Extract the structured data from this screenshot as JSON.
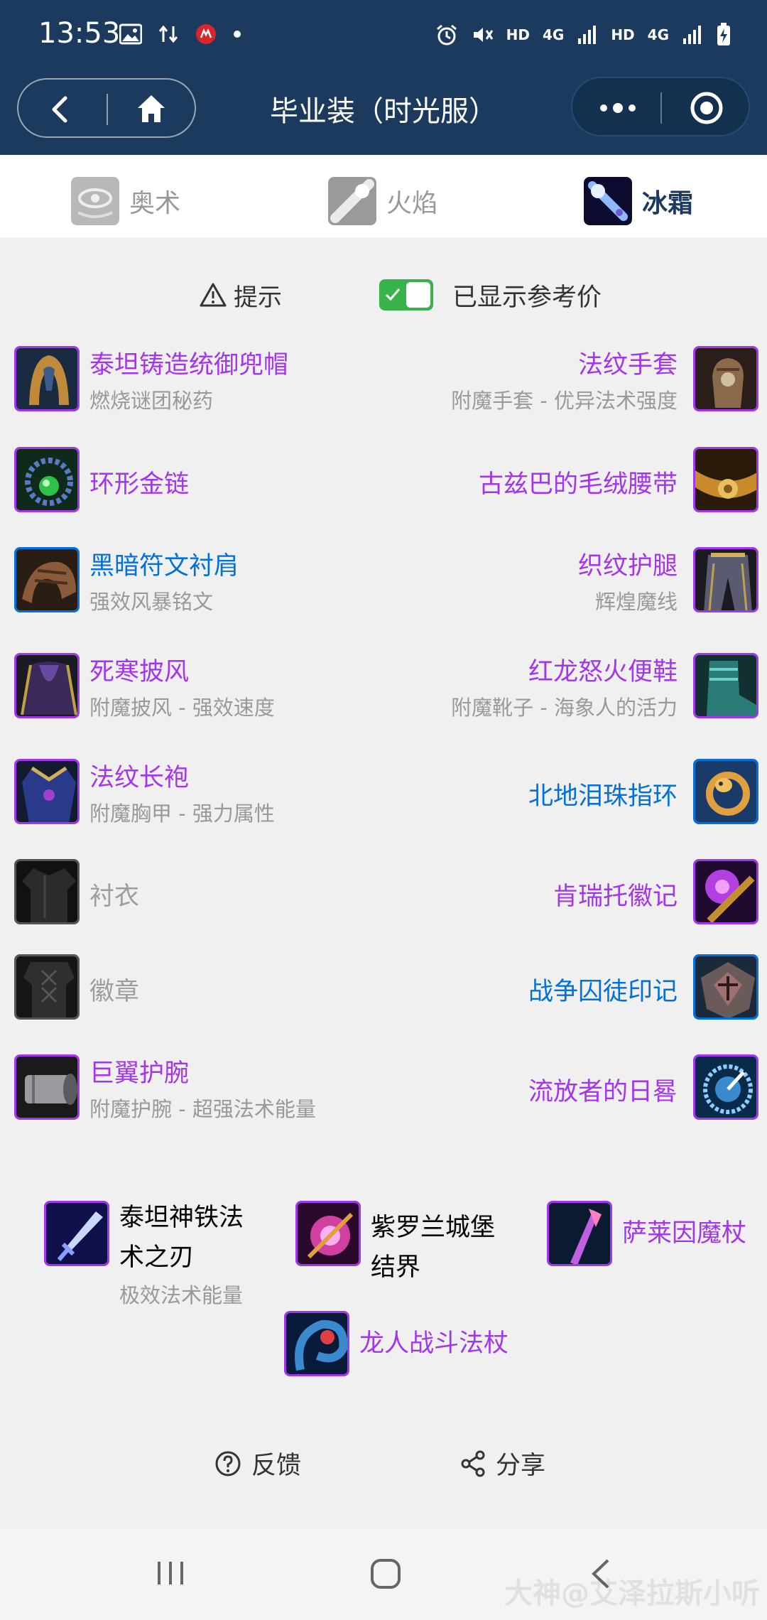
{
  "status": {
    "time": "13:53",
    "network1": "HD",
    "network2": "4G",
    "network3": "HD",
    "network4": "4G"
  },
  "nav": {
    "title": "毕业装（时光服）"
  },
  "tabs": [
    {
      "label": "奥术",
      "active": false
    },
    {
      "label": "火焰",
      "active": false
    },
    {
      "label": "冰霜",
      "active": true
    }
  ],
  "hint": {
    "label": "提示",
    "toggle_label": "已显示参考价",
    "toggle_on": true
  },
  "left_items": [
    {
      "name": "泰坦铸造统御兜帽",
      "sub": "燃烧谜团秘药",
      "quality": "purple",
      "icon": "helmet-icon"
    },
    {
      "name": "环形金链",
      "sub": "",
      "quality": "purple",
      "icon": "necklace-icon"
    },
    {
      "name": "黑暗符文衬肩",
      "sub": "强效风暴铭文",
      "quality": "blue",
      "icon": "shoulder-icon"
    },
    {
      "name": "死寒披风",
      "sub": "附魔披风 - 强效速度",
      "quality": "purple",
      "icon": "cloak-icon"
    },
    {
      "name": "法纹长袍",
      "sub": "附魔胸甲 - 强力属性",
      "quality": "purple",
      "icon": "robe-icon"
    },
    {
      "name": "衬衣",
      "sub": "",
      "quality": "grey",
      "icon": "shirt-icon"
    },
    {
      "name": "徽章",
      "sub": "",
      "quality": "grey",
      "icon": "tabard-icon"
    },
    {
      "name": "巨翼护腕",
      "sub": "附魔护腕 - 超强法术能量",
      "quality": "purple",
      "icon": "bracer-icon"
    }
  ],
  "right_items": [
    {
      "name": "法纹手套",
      "sub": "附魔手套 - 优异法术强度",
      "quality": "purple",
      "icon": "gloves-icon"
    },
    {
      "name": "古兹巴的毛绒腰带",
      "sub": "",
      "quality": "purple",
      "icon": "belt-icon"
    },
    {
      "name": "织纹护腿",
      "sub": "辉煌魔线",
      "quality": "purple",
      "icon": "legs-icon"
    },
    {
      "name": "红龙怒火便鞋",
      "sub": "附魔靴子 - 海象人的活力",
      "quality": "purple",
      "icon": "boots-icon"
    },
    {
      "name": "北地泪珠指环",
      "sub": "",
      "quality": "blue",
      "icon": "ring-icon"
    },
    {
      "name": "肯瑞托徽记",
      "sub": "",
      "quality": "purple",
      "icon": "signet-icon"
    },
    {
      "name": "战争囚徒印记",
      "sub": "",
      "quality": "blue",
      "icon": "trinket-icon"
    },
    {
      "name": "流放者的日晷",
      "sub": "",
      "quality": "purple",
      "icon": "sundial-icon"
    }
  ],
  "weapons": [
    {
      "name_line1": "泰坦神铁法",
      "name_line2": "术之刃",
      "sub": "极效法术能量",
      "quality": "purple",
      "icon": "dagger-icon"
    },
    {
      "name_line1": "紫罗兰城堡",
      "name_line2": "结界",
      "sub": "",
      "quality": "purple",
      "icon": "offhand-icon"
    },
    {
      "name_line1": "萨莱因魔杖",
      "name_line2": "",
      "sub": "",
      "quality": "purple",
      "icon": "wand-icon"
    },
    {
      "name_line1": "龙人战斗法杖",
      "name_line2": "",
      "sub": "",
      "quality": "purple",
      "icon": "staff-icon"
    }
  ],
  "actions": {
    "feedback": "反馈",
    "share": "分享"
  },
  "watermark": "大神@艾泽拉斯小听",
  "colors": {
    "header_bg": "#1b3a5e",
    "epic": "#a335ee",
    "rare": "#0070dd",
    "poor": "#9d9d9d",
    "toggle_on": "#38b24a"
  }
}
